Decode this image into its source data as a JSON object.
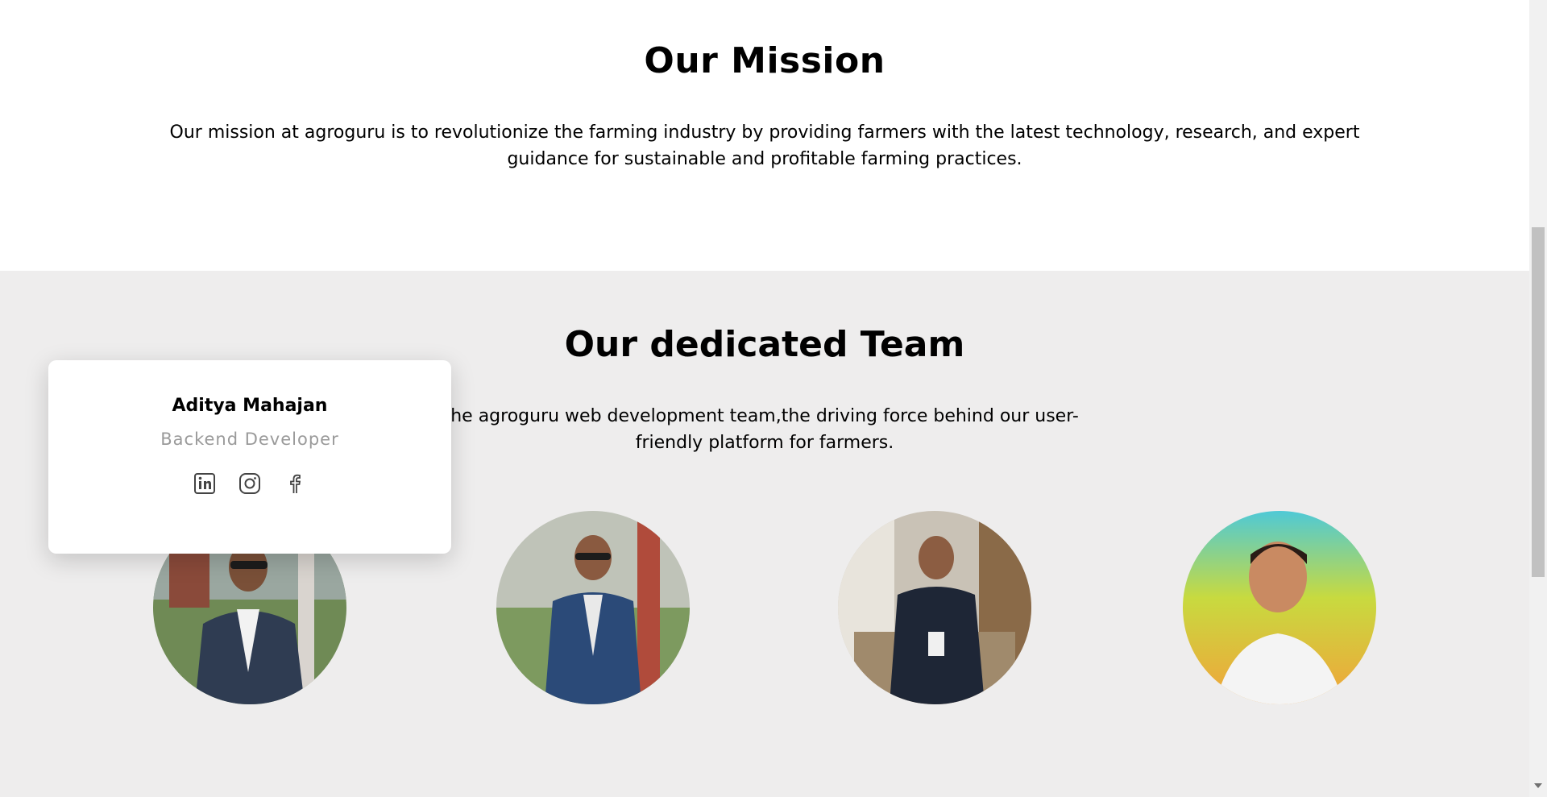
{
  "mission": {
    "title": "Our Mission",
    "text": "Our mission at agroguru is to revolutionize the farming industry by providing farmers with the latest technology, research, and expert guidance for sustainable and profitable farming practices."
  },
  "team": {
    "title": "Our dedicated Team",
    "text": "he agroguru web development team,the driving force behind our user-friendly platform for farmers."
  },
  "card": {
    "name": "Aditya Mahajan",
    "role": "Backend Developer",
    "socials": [
      "linkedin-icon",
      "instagram-icon",
      "facebook-icon"
    ]
  },
  "colors": {
    "section_bg": "#eeeded",
    "card_bg": "#ffffff",
    "muted_text": "#9a9a9a"
  }
}
